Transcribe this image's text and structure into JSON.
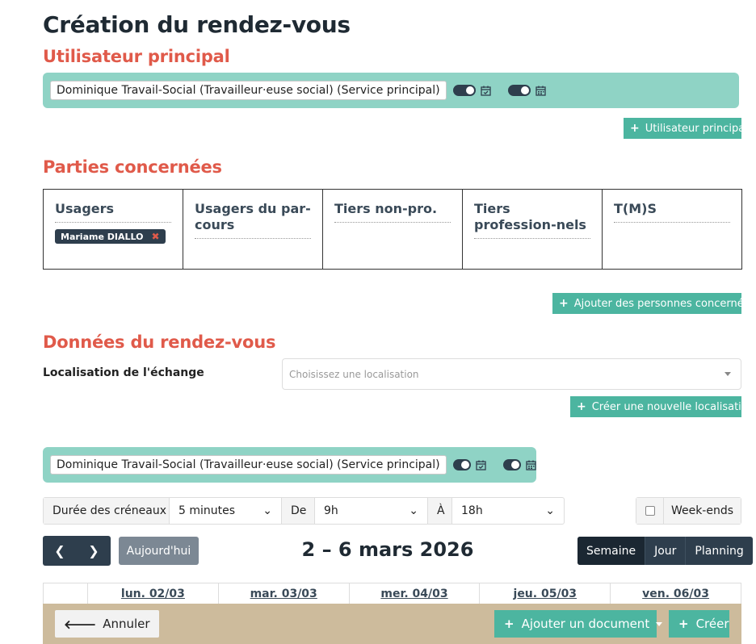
{
  "page": {
    "title": "Création du rendez-vous"
  },
  "main_user": {
    "heading": "Utilisateur principal",
    "chip": "Dominique Travail-Social (Travailleur·euse social) (Service principal)",
    "add_button": "Utilisateur principal"
  },
  "parties": {
    "heading": "Parties concernées",
    "columns": [
      {
        "title": "Usagers"
      },
      {
        "title": "Usagers du par-cours"
      },
      {
        "title": "Tiers non-pro."
      },
      {
        "title": "Tiers profession-nels"
      },
      {
        "title": "T(M)S"
      }
    ],
    "usagers_tag": "Mariame DIALLO",
    "add_button": "Ajouter des personnes concernées"
  },
  "rdv": {
    "heading": "Données du rendez-vous",
    "location_label": "Localisation de l'échange",
    "location_placeholder": "Choisissez une localisation",
    "new_location_button": "Créer une nouvelle localisation",
    "user_chip": "Dominique Travail-Social (Travailleur·euse social) (Service principal)"
  },
  "filters": {
    "slot_label": "Durée des créneaux",
    "slot_value": "5 minutes",
    "from_label": "De",
    "from_value": "9h",
    "to_label": "À",
    "to_value": "18h",
    "weekends_label": "Week-ends",
    "weekends_checked": false
  },
  "calendar": {
    "today_button": "Aujourd'hui",
    "period": "2 – 6 mars 2026",
    "views": [
      "Semaine",
      "Jour",
      "Planning"
    ],
    "active_view": "Semaine",
    "days": [
      "lun. 02/03",
      "mar. 03/03",
      "mer. 04/03",
      "jeu. 05/03",
      "ven. 06/03"
    ]
  },
  "footer": {
    "cancel": "Annuler",
    "add_document": "Ajouter un document",
    "create": "Créer"
  },
  "colors": {
    "accent_red": "#e05a4a",
    "teal": "#4cb5a0",
    "userbar": "#8fd3c5",
    "dark": "#2e3e4d",
    "footer": "#cdbb9c"
  }
}
